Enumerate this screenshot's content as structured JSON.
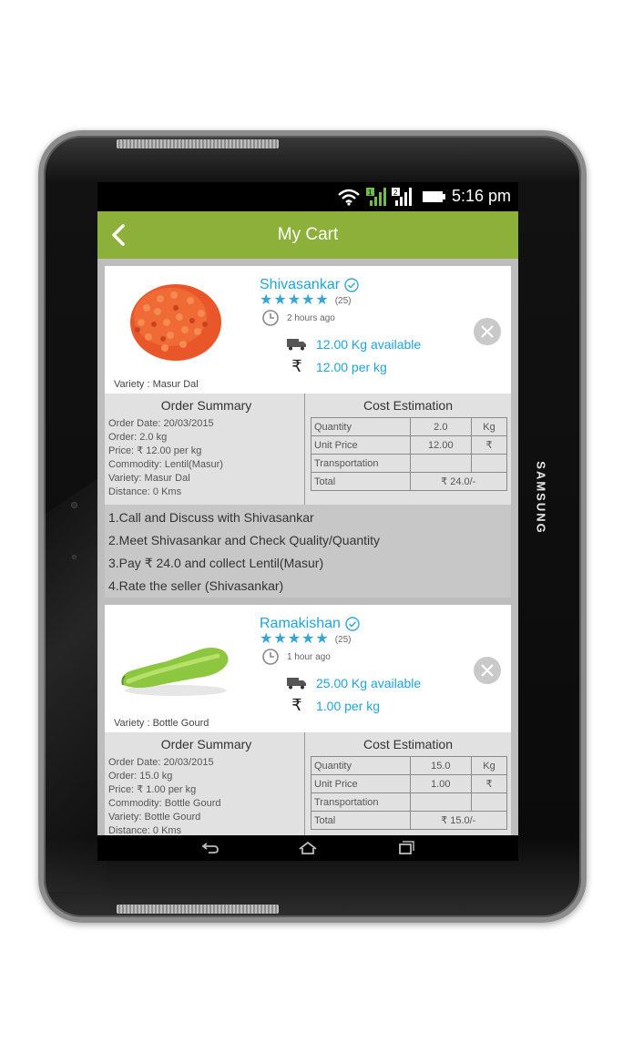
{
  "device": {
    "brand": "SAMSUNG"
  },
  "status_bar": {
    "time": "5:16 pm",
    "sim1": "1",
    "sim2": "2"
  },
  "app_bar": {
    "title": "My Cart"
  },
  "cart": [
    {
      "seller": "Shivasankar",
      "rating_count": "(25)",
      "posted_ago": "2 hours ago",
      "available": "12.00 Kg available",
      "price": "12.00 per kg",
      "variety_label": "Variety : Masur Dal",
      "order_summary_title": "Order Summary",
      "cost_estimation_title": "Cost Estimation",
      "order_lines": [
        "Order Date: 20/03/2015",
        "Order: 2.0 kg",
        "Price: ₹ 12.00 per kg",
        "Commodity: Lentil(Masur)",
        "Variety: Masur Dal",
        "Distance: 0 Kms"
      ],
      "cost_table": [
        {
          "label": "Quantity",
          "value": "2.0",
          "unit": "Kg"
        },
        {
          "label": "Unit Price",
          "value": "12.00",
          "unit": "₹"
        },
        {
          "label": "Transportation",
          "value": "",
          "unit": ""
        },
        {
          "label": "Total",
          "value": "₹ 24.0/-",
          "unit": ""
        }
      ],
      "steps": [
        "1.Call and Discuss with Shivasankar",
        "2.Meet Shivasankar and Check Quality/Quantity",
        "3.Pay ₹ 24.0 and collect Lentil(Masur)",
        "4.Rate the seller (Shivasankar)"
      ]
    },
    {
      "seller": "Ramakishan",
      "rating_count": "(25)",
      "posted_ago": "1 hour ago",
      "available": "25.00 Kg available",
      "price": "1.00 per kg",
      "variety_label": "Variety : Bottle Gourd",
      "order_summary_title": "Order Summary",
      "cost_estimation_title": "Cost Estimation",
      "order_lines": [
        "Order Date: 20/03/2015",
        "Order: 15.0 kg",
        "Price: ₹ 1.00 per kg",
        "Commodity: Bottle Gourd",
        "Variety: Bottle Gourd",
        "Distance: 0 Kms"
      ],
      "cost_table": [
        {
          "label": "Quantity",
          "value": "15.0",
          "unit": "Kg"
        },
        {
          "label": "Unit Price",
          "value": "1.00",
          "unit": "₹"
        },
        {
          "label": "Transportation",
          "value": "",
          "unit": ""
        },
        {
          "label": "Total",
          "value": "₹ 15.0/-",
          "unit": ""
        }
      ]
    }
  ],
  "colors": {
    "accent_green": "#8db03a",
    "link_blue": "#1ea6d8"
  }
}
